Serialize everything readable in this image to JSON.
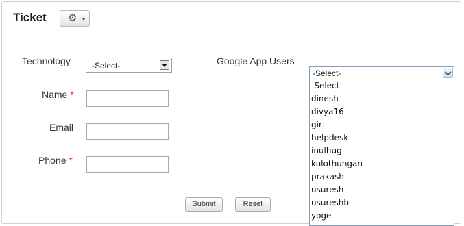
{
  "form": {
    "title": "Ticket",
    "gear_icon": "gear-icon",
    "fields": {
      "technology": {
        "label": "Technology",
        "selected": "-Select-"
      },
      "name": {
        "label": "Name",
        "required_mark": "*",
        "value": ""
      },
      "email": {
        "label": "Email",
        "value": ""
      },
      "phone": {
        "label": "Phone",
        "required_mark": "*",
        "value": ""
      }
    },
    "google_app_users": {
      "label": "Google App Users",
      "selected": "-Select-",
      "options": [
        "-Select-",
        "dinesh",
        "divya16",
        "giri",
        "helpdesk",
        "inulhug",
        "kulothungan",
        "prakash",
        "usuresh",
        "usureshb",
        "yoge"
      ]
    },
    "buttons": {
      "submit": "Submit",
      "reset": "Reset"
    }
  }
}
